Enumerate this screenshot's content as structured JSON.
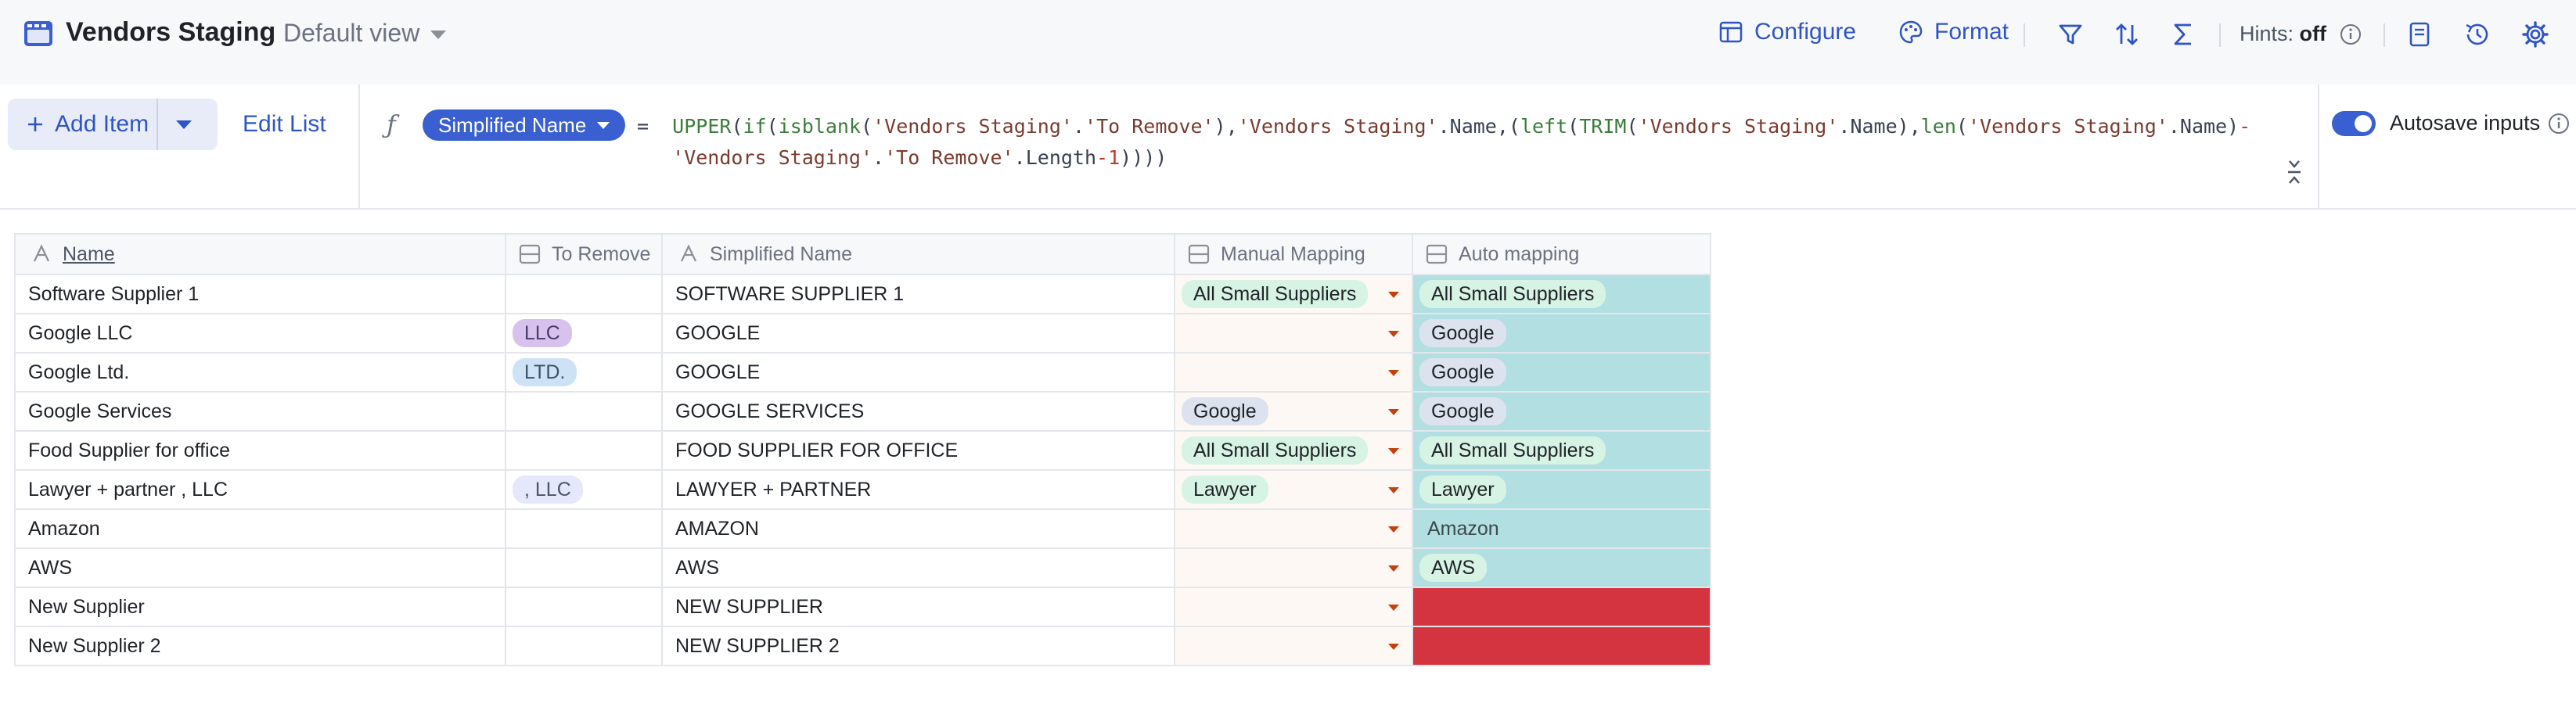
{
  "header": {
    "title": "Vendors Staging",
    "view": "Default view",
    "configure": "Configure",
    "format": "Format",
    "hints_label": "Hints:",
    "hints_value": "off",
    "app_icon": "table-icon",
    "accent_color": "#2f55c4"
  },
  "toolbar": {
    "add_item": "Add Item",
    "edit_list": "Edit List",
    "column_pill": "Simplified Name",
    "formula_equals": "=",
    "autosave_label": "Autosave inputs",
    "autosave_on": true
  },
  "columns": [
    "Name",
    "To Remove",
    "Simplified Name",
    "Manual Mapping",
    "Auto mapping"
  ],
  "rows": [
    {
      "name": "Software Supplier 1",
      "to_remove": "",
      "simplified": "SOFTWARE SUPPLIER 1",
      "manual": "All Small Suppliers",
      "auto": "All Small Suppliers"
    },
    {
      "name": "Google LLC",
      "to_remove": "LLC",
      "simplified": "GOOGLE",
      "manual": "",
      "auto": "Google"
    },
    {
      "name": "Google Ltd.",
      "to_remove": "LTD.",
      "simplified": "GOOGLE",
      "manual": "",
      "auto": "Google"
    },
    {
      "name": "Google Services",
      "to_remove": "",
      "simplified": "GOOGLE SERVICES",
      "manual": "Google",
      "auto": "Google"
    },
    {
      "name": "Food Supplier for office",
      "to_remove": "",
      "simplified": "FOOD SUPPLIER FOR OFFICE",
      "manual": "All Small Suppliers",
      "auto": "All Small Suppliers"
    },
    {
      "name": "Lawyer + partner , LLC",
      "to_remove": ", LLC",
      "simplified": "LAWYER + PARTNER",
      "manual": "Lawyer",
      "auto": "Lawyer"
    },
    {
      "name": "Amazon",
      "to_remove": "",
      "simplified": "AMAZON",
      "manual": "",
      "auto": "Amazon"
    },
    {
      "name": "AWS",
      "to_remove": "",
      "simplified": "AWS",
      "manual": "",
      "auto": "AWS"
    },
    {
      "name": "New Supplier",
      "to_remove": "",
      "simplified": "NEW SUPPLIER",
      "manual": "",
      "auto": ""
    },
    {
      "name": "New Supplier 2",
      "to_remove": "",
      "simplified": "NEW SUPPLIER 2",
      "manual": "",
      "auto": ""
    }
  ],
  "colors": {
    "auto_mapped_bg": "#b2dfe2",
    "auto_missing_bg": "#d4343f",
    "manual_bg": "#fef8f4"
  }
}
